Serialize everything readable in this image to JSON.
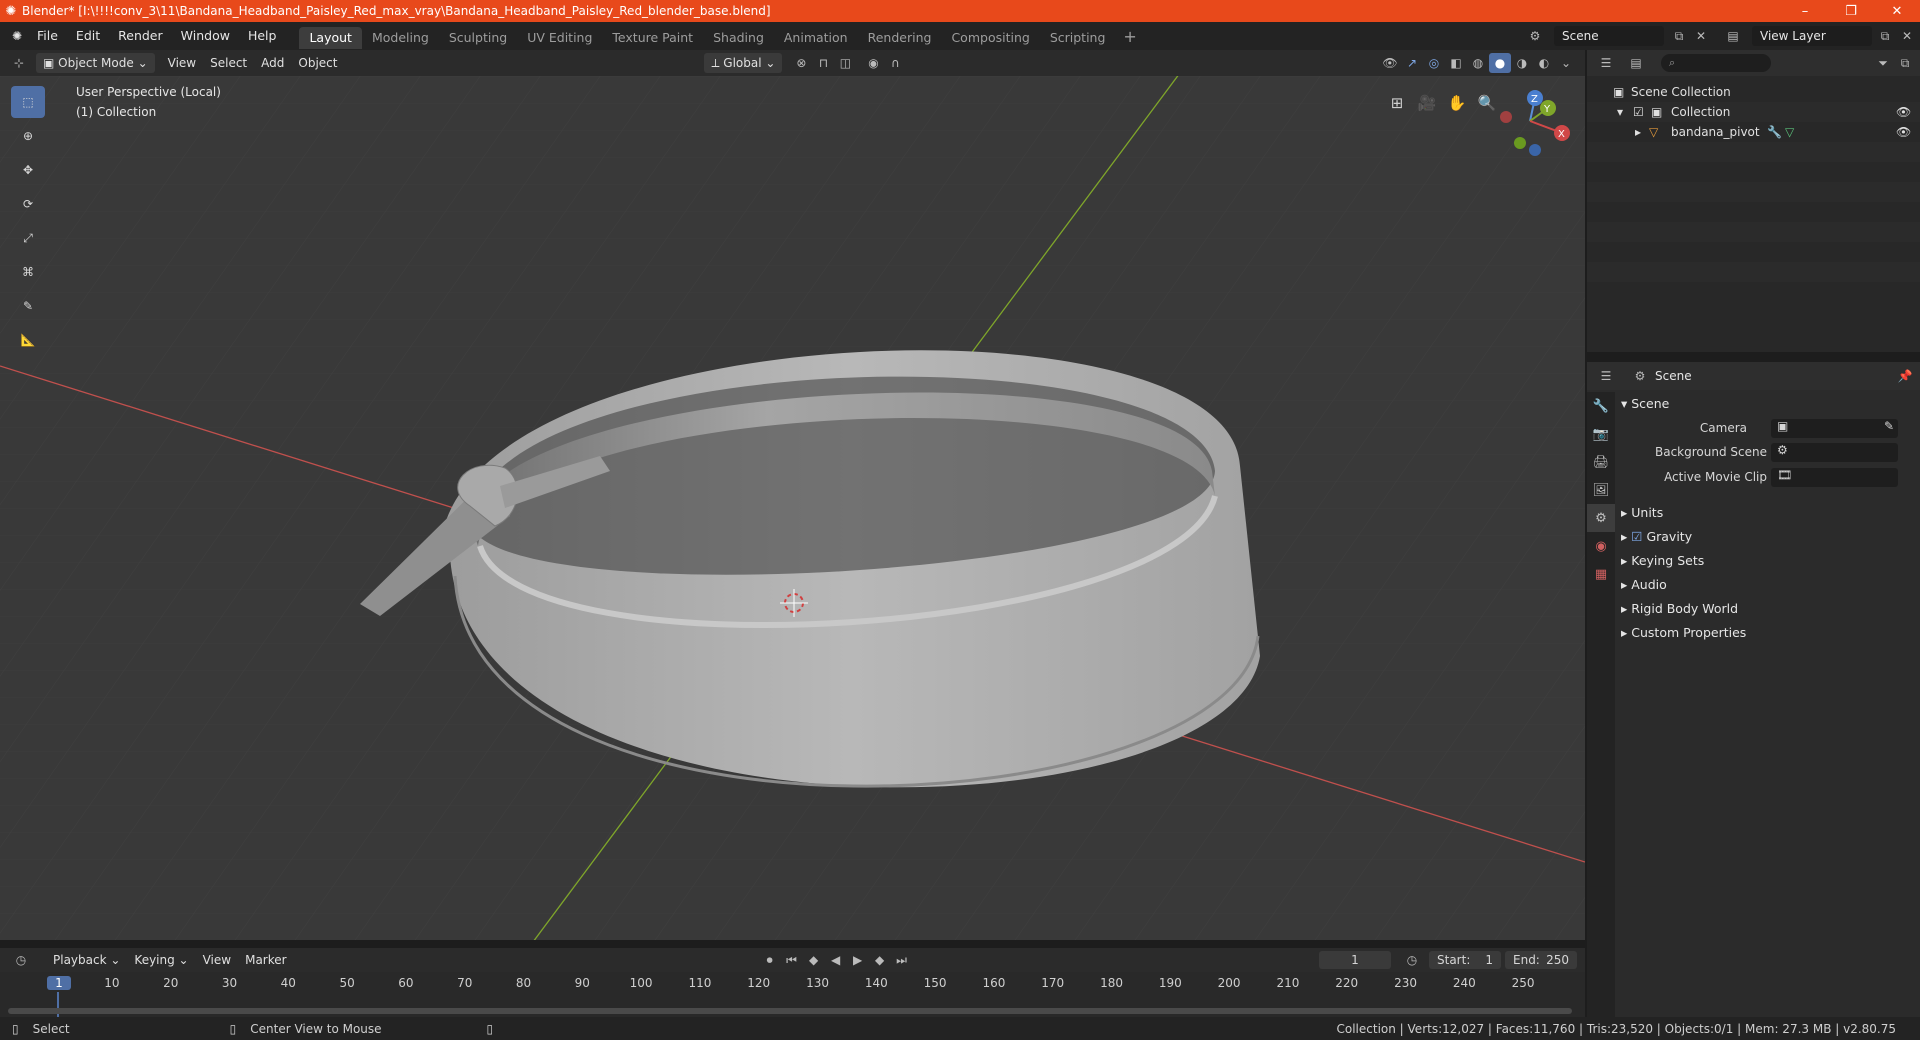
{
  "window": {
    "title": "Blender* [I:\\!!!!conv_3\\11\\Bandana_Headband_Paisley_Red_max_vray\\Bandana_Headband_Paisley_Red_blender_base.blend]",
    "controls": {
      "minimize": "–",
      "maximize": "❐",
      "close": "✕"
    }
  },
  "menu": [
    "File",
    "Edit",
    "Render",
    "Window",
    "Help"
  ],
  "workspaces": [
    "Layout",
    "Modeling",
    "Sculpting",
    "UV Editing",
    "Texture Paint",
    "Shading",
    "Animation",
    "Rendering",
    "Compositing",
    "Scripting"
  ],
  "active_workspace": "Layout",
  "scene_selector": {
    "scene": "Scene",
    "view_layer": "View Layer"
  },
  "viewport_header": {
    "mode": "Object Mode",
    "menus": [
      "View",
      "Select",
      "Add",
      "Object"
    ],
    "transform_orientation": "Global"
  },
  "viewport": {
    "perspective_label": "User Perspective (Local)",
    "collection_label": "(1) Collection",
    "gizmo": {
      "x": "X",
      "y": "Y",
      "z": "Z"
    }
  },
  "outliner": {
    "root": "Scene Collection",
    "collection": "Collection",
    "object": "bandana_pivot"
  },
  "properties": {
    "context": "Scene",
    "section": "Scene",
    "fields": [
      {
        "label": "Camera"
      },
      {
        "label": "Background Scene"
      },
      {
        "label": "Active Movie Clip"
      }
    ],
    "subsections": [
      "Units",
      "Gravity",
      "Keying Sets",
      "Audio",
      "Rigid Body World",
      "Custom Properties"
    ]
  },
  "timeline": {
    "menus": [
      "Playback",
      "Keying",
      "View",
      "Marker"
    ],
    "current_frame": "1",
    "start_label": "Start:",
    "start": "1",
    "end_label": "End:",
    "end": "250",
    "ruler": [
      "1",
      "10",
      "20",
      "30",
      "40",
      "50",
      "60",
      "70",
      "80",
      "90",
      "100",
      "110",
      "120",
      "130",
      "140",
      "150",
      "160",
      "170",
      "180",
      "190",
      "200",
      "210",
      "220",
      "230",
      "240",
      "250"
    ]
  },
  "statusbar": {
    "select": "Select",
    "center_view": "Center View to Mouse",
    "stats": "Collection | Verts:12,027 | Faces:11,760 | Tris:23,520 | Objects:0/1 | Mem: 27.3 MB | v2.80.75"
  },
  "colors": {
    "titlebar": "#e8491b",
    "viewport_bg": "#393939",
    "x_axis": "#c0504d",
    "y_axis": "#7fa62a",
    "active_tool": "#4f6fa5"
  }
}
